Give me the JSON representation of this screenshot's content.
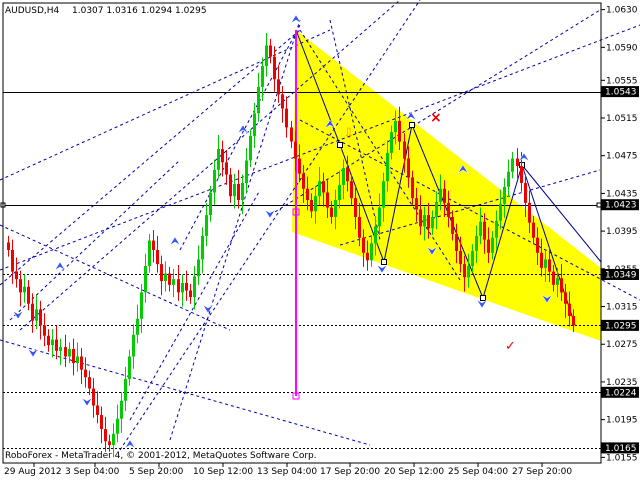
{
  "window": {
    "symbol_timeframe": "AUDUSD,H4",
    "ohlc": "1.0307 1.0316 1.0294 1.0295",
    "footer": "RoboForex - MetaTrader 4, © 2001-2012, MetaQuotes Software Corp."
  },
  "colors": {
    "background": "#ffffff",
    "bull_candle": "#00cc00",
    "bear_candle": "#ee0000",
    "channel_fill": "#ffff00",
    "trendline": "#0000aa",
    "target_line": "#ff00ff",
    "label_box": "#000000",
    "label_text": "#ffffff",
    "cross": "#ee0000",
    "check": "#ee0000",
    "arrow_marker": "#ff9900"
  },
  "chart_data": {
    "type": "candlestick",
    "x_ticks": [
      "29 Aug 2012",
      "3 Sep 04:00",
      "5 Sep 20:00",
      "10 Sep 12:00",
      "13 Sep 04:00",
      "17 Sep 20:00",
      "20 Sep 12:00",
      "25 Sep 04:00",
      "27 Sep 20:00"
    ],
    "y_ticks": [
      "1.0630",
      "1.0590",
      "1.0555",
      "1.0515",
      "1.0475",
      "1.0435",
      "1.0395",
      "1.0355",
      "1.0315",
      "1.0275",
      "1.0235",
      "1.0195",
      "1.0155"
    ],
    "ylim": [
      1.0149,
      1.0637
    ],
    "horizontal_levels": [
      {
        "value": 1.0543,
        "label": "1.0543"
      },
      {
        "value": 1.0423,
        "label": "1.0423"
      },
      {
        "value": 1.0349,
        "label": "1.0349"
      },
      {
        "value": 1.0295,
        "label": "1.0295"
      },
      {
        "value": 1.0224,
        "label": "1.0224"
      },
      {
        "value": 1.0165,
        "label": "1.0165"
      }
    ],
    "current_price_label": "1.0295",
    "closes": [
      1.0375,
      1.0352,
      1.0344,
      1.033,
      1.0336,
      1.0318,
      1.03,
      1.0312,
      1.0295,
      1.0284,
      1.0274,
      1.028,
      1.0268,
      1.0272,
      1.0262,
      1.027,
      1.0255,
      1.0262,
      1.0248,
      1.024,
      1.0228,
      1.021,
      1.02,
      1.0185,
      1.0172,
      1.0168,
      1.018,
      1.0196,
      1.0215,
      1.0238,
      1.0262,
      1.0285,
      1.0302,
      1.033,
      1.0358,
      1.0385,
      1.0375,
      1.036,
      1.0342,
      1.035,
      1.0338,
      1.0344,
      1.033,
      1.034,
      1.0332,
      1.0325,
      1.0347,
      1.0365,
      1.039,
      1.0412,
      1.0436,
      1.046,
      1.0482,
      1.0468,
      1.0455,
      1.0432,
      1.0445,
      1.0428,
      1.0446,
      1.047,
      1.0496,
      1.052,
      1.0548,
      1.057,
      1.0592,
      1.058,
      1.0556,
      1.054,
      1.0525,
      1.0505,
      1.049,
      1.0472,
      1.0456,
      1.044,
      1.0428,
      1.0416,
      1.0432,
      1.0448,
      1.0436,
      1.042,
      1.041,
      1.0428,
      1.0444,
      1.0462,
      1.0448,
      1.043,
      1.041,
      1.0388,
      1.0372,
      1.0364,
      1.0382,
      1.04,
      1.042,
      1.0448,
      1.0478,
      1.05,
      1.0512,
      1.049,
      1.0472,
      1.0452,
      1.043,
      1.0418,
      1.04,
      1.0412,
      1.0398,
      1.041,
      1.0426,
      1.044,
      1.0425,
      1.041,
      1.0392,
      1.0374,
      1.036,
      1.0346,
      1.0358,
      1.0374,
      1.039,
      1.0405,
      1.0386,
      1.0372,
      1.0388,
      1.0406,
      1.0424,
      1.0442,
      1.0458,
      1.0472,
      1.0464,
      1.0446,
      1.0425,
      1.0404,
      1.0388,
      1.0372,
      1.0356,
      1.0365,
      1.0352,
      1.0338,
      1.0345,
      1.033,
      1.0318,
      1.0305,
      1.0295
    ]
  },
  "annotations": {
    "cross_mark": "×",
    "check_mark": "✓",
    "arrow_mark": "⇩"
  }
}
